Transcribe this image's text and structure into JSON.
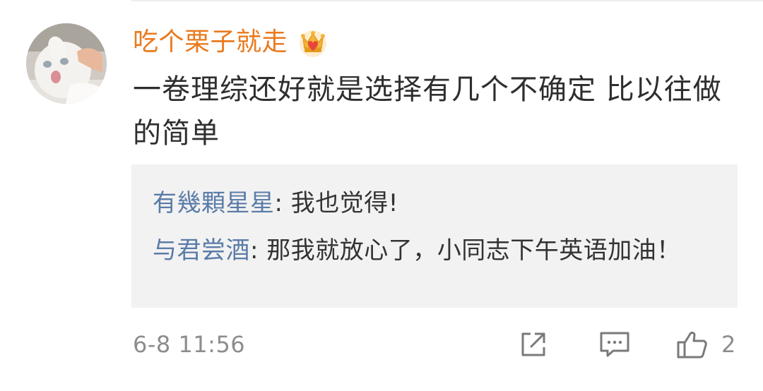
{
  "comment": {
    "username": "吃个栗子就走",
    "text": "一卷理综还好就是选择有几个不确定 比以往做的简单",
    "time": "6-8 11:56",
    "like_count": "2",
    "badge_icon": "crown-heart-icon"
  },
  "replies": [
    {
      "author": "有幾顆星星",
      "separator": ": ",
      "text": "我也觉得!"
    },
    {
      "author": "与君尝酒",
      "separator": ": ",
      "text": "那我就放心了，小同志下午英语加油！"
    }
  ],
  "colors": {
    "username": "#e97a1e",
    "reply_author": "#5a7ca8",
    "body_text": "#2e2e2e",
    "meta_text": "#8d8d8d",
    "reply_background": "#f2f2f2"
  },
  "icons": {
    "share": "share-external-icon",
    "comment": "comment-bubble-icon",
    "like": "thumbs-up-icon"
  }
}
